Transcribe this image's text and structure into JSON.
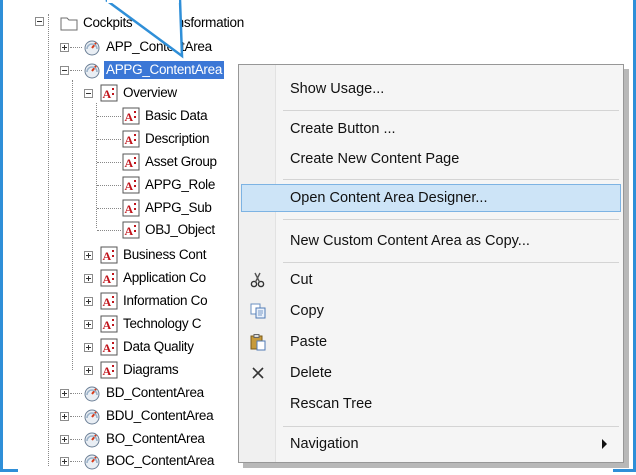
{
  "tree": {
    "root_label": "Cockpits - IT Transformation",
    "items": [
      {
        "label": "APP_ContentArea",
        "type": "content-area"
      },
      {
        "label": "APPG_ContentArea",
        "type": "content-area",
        "selected": true
      },
      {
        "label": "Overview",
        "type": "page"
      },
      {
        "label": "Basic Data",
        "type": "page"
      },
      {
        "label": "Description",
        "type": "page"
      },
      {
        "label": "Asset Group",
        "type": "page"
      },
      {
        "label": "APPG_Role",
        "type": "page"
      },
      {
        "label": "APPG_Sub",
        "type": "page"
      },
      {
        "label": "OBJ_Object",
        "type": "page"
      },
      {
        "label": "Business Cont",
        "type": "page"
      },
      {
        "label": "Application Co",
        "type": "page"
      },
      {
        "label": "Information Co",
        "type": "page"
      },
      {
        "label": "Technology C",
        "type": "page"
      },
      {
        "label": "Data Quality",
        "type": "page"
      },
      {
        "label": "Diagrams",
        "type": "page"
      },
      {
        "label": "BD_ContentArea",
        "type": "content-area"
      },
      {
        "label": "BDU_ContentArea",
        "type": "content-area"
      },
      {
        "label": "BO_ContentArea",
        "type": "content-area"
      },
      {
        "label": "BOC_ContentArea",
        "type": "content-area"
      }
    ]
  },
  "context_menu": {
    "items": [
      {
        "label": "Show Usage...",
        "icon": ""
      },
      {
        "label": "Create Button ...",
        "icon": ""
      },
      {
        "label": "Create New Content Page",
        "icon": ""
      },
      {
        "label": "Open Content Area Designer...",
        "icon": "",
        "highlighted": true
      },
      {
        "label": "New Custom Content Area as Copy...",
        "icon": ""
      },
      {
        "label": "Cut",
        "icon": "scissors-icon"
      },
      {
        "label": "Copy",
        "icon": "copy-icon"
      },
      {
        "label": "Paste",
        "icon": "paste-icon"
      },
      {
        "label": "Delete",
        "icon": "delete-x-icon"
      },
      {
        "label": "Rescan Tree",
        "icon": ""
      },
      {
        "label": "Navigation",
        "icon": "",
        "submenu": true
      }
    ]
  },
  "colors": {
    "selection": "#3b77d6",
    "menu_highlight": "#cde4f7",
    "frame_blue": "#2f8fd8",
    "page_icon_red": "#c0141b"
  }
}
